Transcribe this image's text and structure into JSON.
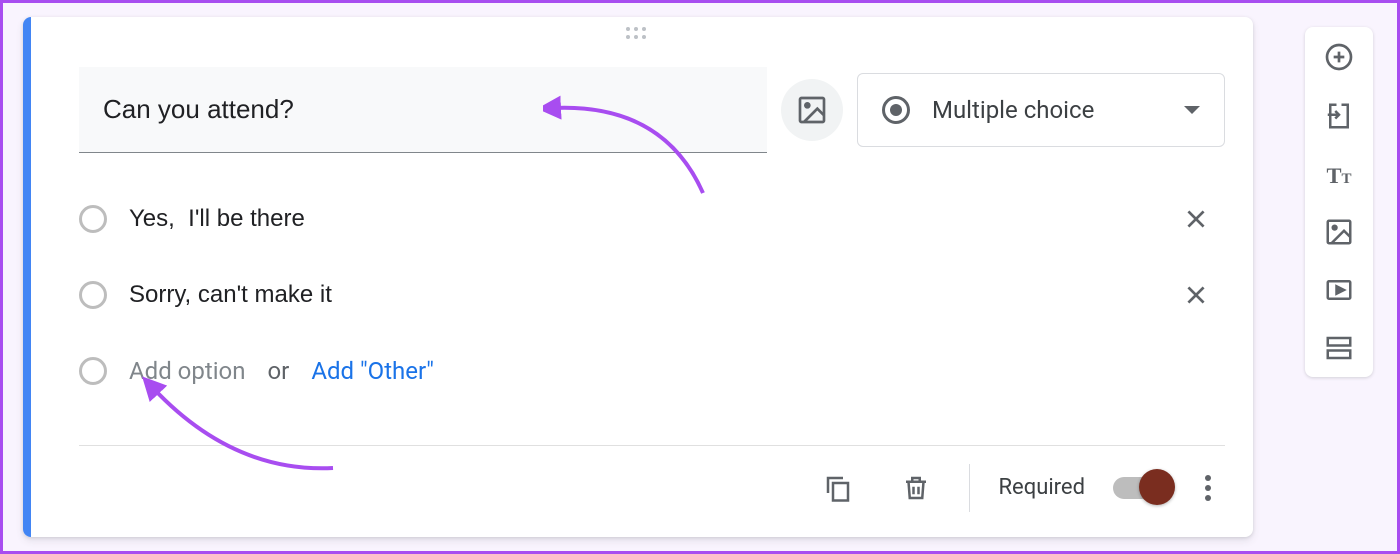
{
  "question": "Can you attend?",
  "type_selector": {
    "label": "Multiple choice"
  },
  "options": [
    {
      "text": "Yes,  I'll be there"
    },
    {
      "text": "Sorry, can't make it"
    }
  ],
  "add_option_placeholder": "Add option",
  "or_text": "or",
  "add_other_label": "Add \"Other\"",
  "footer": {
    "required_label": "Required"
  }
}
